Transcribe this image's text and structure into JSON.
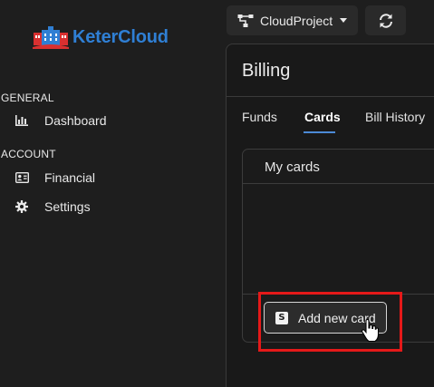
{
  "brand": {
    "name": "KeterCloud"
  },
  "sidebar": {
    "sections": [
      {
        "title": "GENERAL",
        "items": [
          {
            "label": "Dashboard",
            "icon": "chart-icon"
          }
        ]
      },
      {
        "title": "ACCOUNT",
        "items": [
          {
            "label": "Financial",
            "icon": "id-card-icon"
          },
          {
            "label": "Settings",
            "icon": "gear-icon"
          }
        ]
      }
    ]
  },
  "topbar": {
    "project": "CloudProject",
    "refresh_icon": "refresh-icon",
    "project_icon": "network-icon"
  },
  "page": {
    "title": "Billing",
    "tabs": [
      {
        "label": "Funds"
      },
      {
        "label": "Cards",
        "active": true
      },
      {
        "label": "Bill History"
      }
    ]
  },
  "cards": {
    "title": "My cards",
    "add_button": "Add new card",
    "add_button_icon": "S"
  },
  "colors": {
    "accent": "#2f7fd4",
    "tab_underline": "#4c8ad6",
    "highlight": "#e51919"
  }
}
